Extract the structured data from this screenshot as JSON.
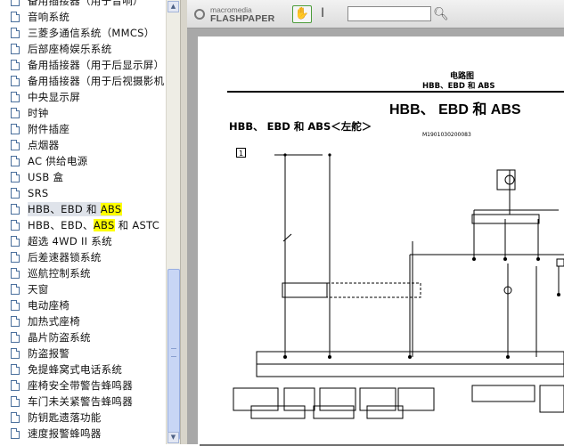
{
  "toc": {
    "items": [
      {
        "label": "备用插接器（用于音响）",
        "selected": false
      },
      {
        "label": "音响系统",
        "selected": false
      },
      {
        "label": "三菱多通信系统（MMCS）",
        "selected": false
      },
      {
        "label": "后部座椅娱乐系统",
        "selected": false
      },
      {
        "label": "备用插接器（用于后显示屏）",
        "selected": false
      },
      {
        "label": "备用插接器（用于后视摄影机",
        "selected": false
      },
      {
        "label": "中央显示屏",
        "selected": false
      },
      {
        "label": "时钟",
        "selected": false
      },
      {
        "label": "附件插座",
        "selected": false
      },
      {
        "label": "点烟器",
        "selected": false
      },
      {
        "label": "AC 供给电源",
        "selected": false
      },
      {
        "label": "USB 盒",
        "selected": false
      },
      {
        "label": "SRS",
        "selected": false
      },
      {
        "label": "HBB、EBD 和 ",
        "highlight": "ABS",
        "selected": true
      },
      {
        "label": "HBB、EBD、",
        "highlight": "ABS",
        "after": " 和 ASTC",
        "selected": false
      },
      {
        "label": "超选 4WD II 系统",
        "selected": false
      },
      {
        "label": "后差速器锁系统",
        "selected": false
      },
      {
        "label": "巡航控制系统",
        "selected": false
      },
      {
        "label": "天窗",
        "selected": false
      },
      {
        "label": "电动座椅",
        "selected": false
      },
      {
        "label": "加热式座椅",
        "selected": false
      },
      {
        "label": "晶片防盗系统",
        "selected": false
      },
      {
        "label": "防盗报警",
        "selected": false
      },
      {
        "label": "免提蜂窝式电话系统",
        "selected": false
      },
      {
        "label": "座椅安全带警告蜂鸣器",
        "selected": false
      },
      {
        "label": "车门未关紧警告蜂鸣器",
        "selected": false
      },
      {
        "label": "防钥匙遗落功能",
        "selected": false
      },
      {
        "label": "速度报警蜂鸣器",
        "selected": false
      }
    ]
  },
  "viewer": {
    "brand_line1": "macromedia",
    "brand_line2": "FLASHPAPER",
    "hand_tool_icon": "hand-icon",
    "text_tool_icon": "text-cursor-icon",
    "search_value": "",
    "search_icon": "magnifier-icon"
  },
  "document": {
    "section": "电路图",
    "subsection": "HBB、EBD 和 ABS",
    "title": "HBB、 EBD 和 ABS",
    "diagram_title": "HBB、 EBD 和 ABS＜左舵＞",
    "diagram_code": "M1901030200083",
    "panel_number": "1"
  },
  "colors": {
    "highlight": "#ffff00",
    "selection": "#dfe3ea",
    "scrollbar_thumb": "#c8d6f5",
    "viewer_bg": "#a8a8a8"
  }
}
